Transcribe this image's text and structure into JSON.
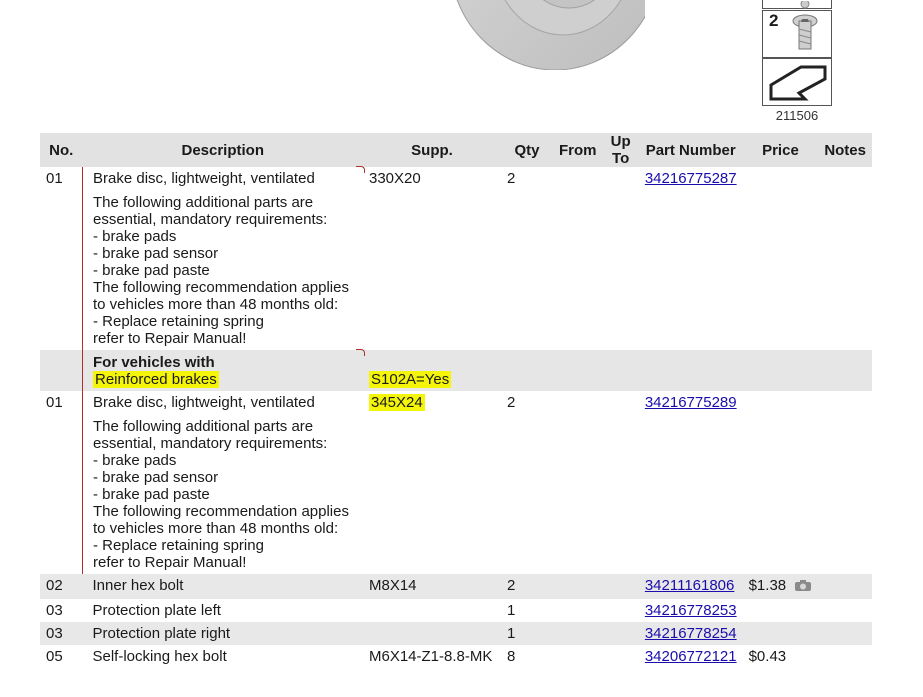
{
  "figure": {
    "caption": "211506",
    "strip_number": "2"
  },
  "table": {
    "headers": {
      "no": "No.",
      "description": "Description",
      "supp": "Supp.",
      "qty": "Qty",
      "from": "From",
      "upto": "Up To",
      "part_number": "Part Number",
      "price": "Price",
      "notes": "Notes"
    },
    "row1": {
      "no": "01",
      "title": "Brake disc, lightweight, ventilated",
      "notes": [
        "The following additional parts are",
        "essential, mandatory requirements:",
        "- brake pads",
        "- brake pad sensor",
        "- brake pad paste",
        "The following recommendation applies",
        "to vehicles more than 48 months old:",
        "- Replace retaining spring",
        "refer to Repair Manual!"
      ],
      "supp": "330X20",
      "qty": "2",
      "part_number": "34216775287"
    },
    "condition": {
      "heading": "For vehicles with",
      "option": "Reinforced brakes",
      "code": "S102A=Yes"
    },
    "row2": {
      "no": "01",
      "title": "Brake disc, lightweight, ventilated",
      "notes": [
        "The following additional parts are",
        "essential, mandatory requirements:",
        "- brake pads",
        "- brake pad sensor",
        "- brake pad paste",
        "The following recommendation applies",
        "to vehicles more than 48 months old:",
        "- Replace retaining spring",
        "refer to Repair Manual!"
      ],
      "supp": "345X24",
      "qty": "2",
      "part_number": "34216775289"
    },
    "rows": [
      {
        "no": "02",
        "desc": "Inner hex bolt",
        "supp": "M8X14",
        "qty": "2",
        "part_number": "34211161806",
        "price": "$1.38",
        "icon": "camera-icon"
      },
      {
        "no": "03",
        "desc": "Protection plate left",
        "supp": "",
        "qty": "1",
        "part_number": "34216778253",
        "price": ""
      },
      {
        "no": "03",
        "desc": "Protection plate right",
        "supp": "",
        "qty": "1",
        "part_number": "34216778254",
        "price": ""
      },
      {
        "no": "05",
        "desc": "Self-locking hex bolt",
        "supp": "M6X14-Z1-8.8-MK",
        "qty": "8",
        "part_number": "34206772121",
        "price": "$0.43"
      }
    ]
  },
  "colors": {
    "highlight": "#f5f50a",
    "header_bg": "#e2e2e2",
    "link": "#1a0dab",
    "bracket": "#b03030"
  }
}
